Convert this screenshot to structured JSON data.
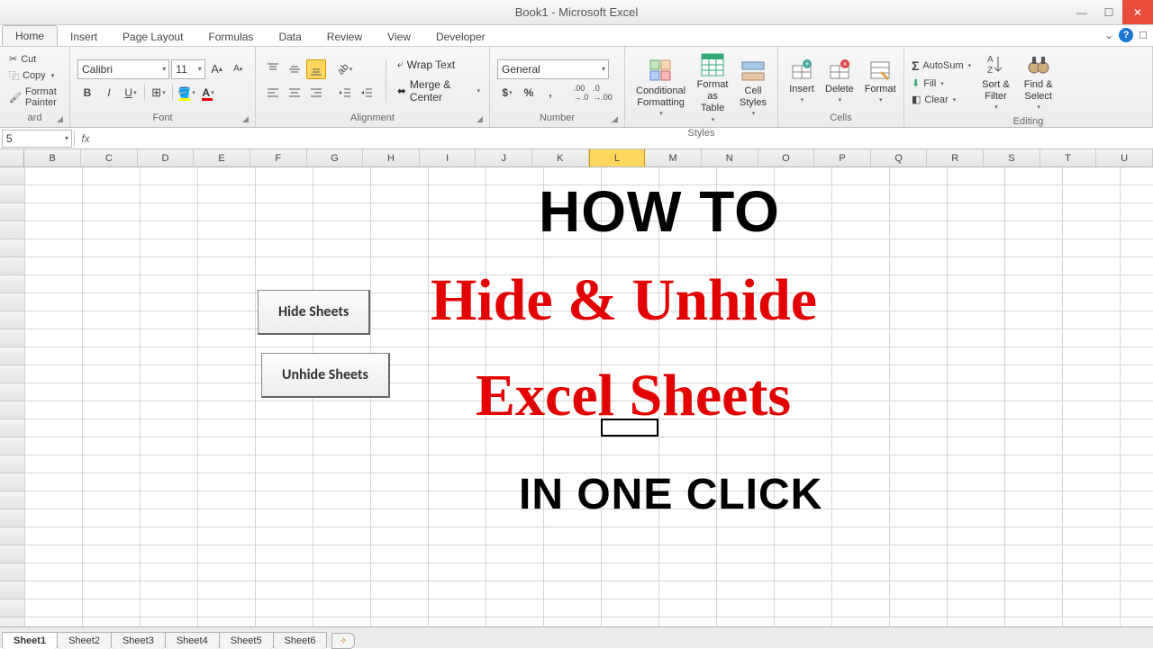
{
  "title": "Book1 - Microsoft Excel",
  "tabs": [
    "Home",
    "Insert",
    "Page Layout",
    "Formulas",
    "Data",
    "Review",
    "View",
    "Developer"
  ],
  "active_tab": 0,
  "clipboard": {
    "cut": "Cut",
    "copy": "Copy",
    "painter": "Format Painter",
    "label": "ard"
  },
  "font": {
    "name": "Calibri",
    "size": "11",
    "label": "Font",
    "bold": "B",
    "italic": "I",
    "underline": "U"
  },
  "alignment": {
    "wrap": "Wrap Text",
    "merge": "Merge & Center",
    "label": "Alignment"
  },
  "number": {
    "format": "General",
    "label": "Number"
  },
  "styles": {
    "cond": "Conditional\nFormatting",
    "table": "Format\nas Table",
    "cell": "Cell\nStyles",
    "label": "Styles"
  },
  "cells": {
    "insert": "Insert",
    "delete": "Delete",
    "format": "Format",
    "label": "Cells"
  },
  "editing": {
    "sum": "AutoSum",
    "fill": "Fill",
    "clear": "Clear",
    "sort": "Sort &\nFilter",
    "find": "Find &\nSelect",
    "label": "Editing"
  },
  "name_box": "5",
  "columns": [
    "B",
    "C",
    "D",
    "E",
    "F",
    "G",
    "H",
    "I",
    "J",
    "K",
    "L",
    "M",
    "N",
    "O",
    "P",
    "Q",
    "R",
    "S",
    "T",
    "U"
  ],
  "selected_col": "L",
  "macro_buttons": {
    "hide": "Hide Sheets",
    "unhide": "Unhide Sheets"
  },
  "overlay": {
    "l1": "HOW TO",
    "l2": "Hide &  Unhide",
    "l3": "Excel Sheets",
    "l4": "IN ONE CLICK"
  },
  "sheets": [
    "Sheet1",
    "Sheet2",
    "Sheet3",
    "Sheet4",
    "Sheet5",
    "Sheet6"
  ],
  "active_sheet": 0
}
